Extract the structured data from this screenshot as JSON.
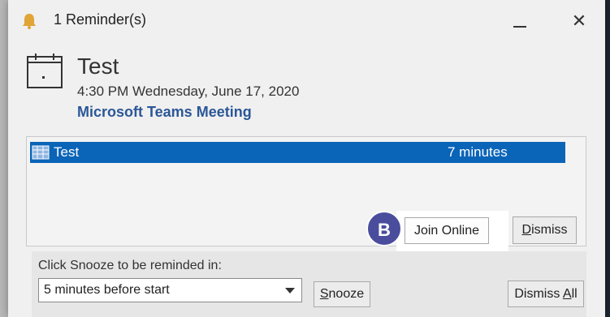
{
  "window": {
    "title": "1 Reminder(s)",
    "close_glyph": "✕"
  },
  "reminder": {
    "subject": "Test",
    "datetime": "4:30 PM Wednesday, June 17, 2020",
    "location": "Microsoft Teams Meeting"
  },
  "list": {
    "rows": [
      {
        "subject": "Test",
        "due_in": "7 minutes"
      }
    ]
  },
  "actions": {
    "join_online": "Join Online",
    "dismiss_accel": "D",
    "dismiss_rest": "ismiss",
    "badge": "B"
  },
  "snooze": {
    "label": "Click Snooze to be reminded in:",
    "selected": "5 minutes before start",
    "snooze_accel": "S",
    "snooze_rest": "nooze",
    "dismiss_all_prefix": "Dismiss ",
    "dismiss_all_accel": "A",
    "dismiss_all_rest": "ll"
  },
  "colors": {
    "selection": "#0a64b8",
    "location_link": "#2b5797",
    "badge": "#4a4d9c"
  },
  "icons": [
    "bell-icon",
    "calendar-icon",
    "appointment-icon",
    "dropdown-arrow-icon"
  ]
}
